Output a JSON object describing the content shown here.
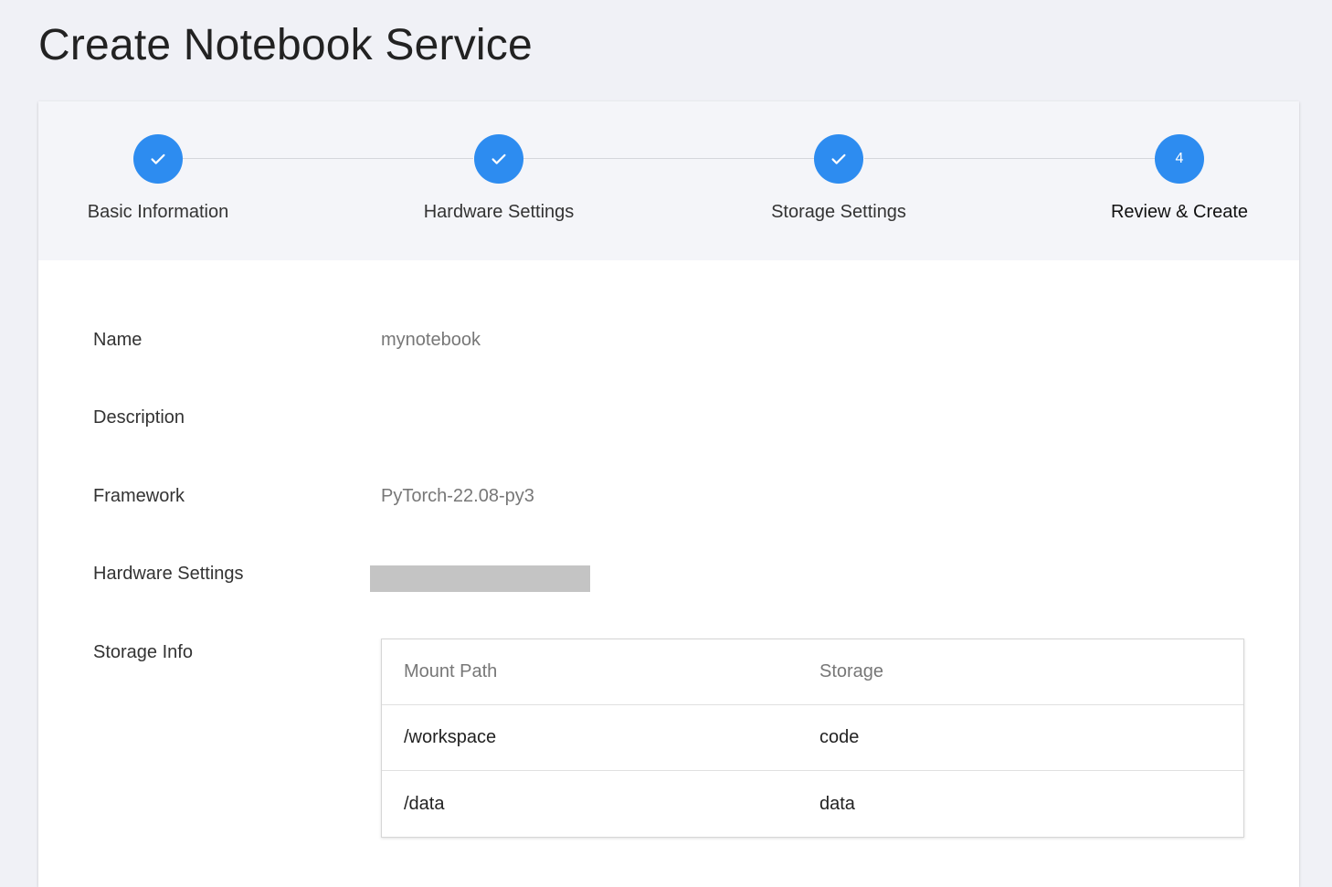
{
  "page": {
    "title": "Create Notebook Service"
  },
  "stepper": {
    "steps": [
      {
        "label": "Basic Information",
        "state": "completed",
        "icon": "check-icon"
      },
      {
        "label": "Hardware Settings",
        "state": "completed",
        "icon": "check-icon"
      },
      {
        "label": "Storage Settings",
        "state": "completed",
        "icon": "check-icon"
      },
      {
        "label": "Review & Create",
        "state": "active",
        "number": "4"
      }
    ],
    "accent_color": "#2d8cf0"
  },
  "review": {
    "name": {
      "label": "Name",
      "value": "mynotebook"
    },
    "description": {
      "label": "Description",
      "value": ""
    },
    "framework": {
      "label": "Framework",
      "value": "PyTorch-22.08-py3"
    },
    "hardware": {
      "label": "Hardware Settings",
      "value_redacted": true
    },
    "storage": {
      "label": "Storage Info",
      "columns": [
        "Mount Path",
        "Storage"
      ],
      "rows": [
        [
          "/workspace",
          "code"
        ],
        [
          "/data",
          "data"
        ]
      ]
    }
  }
}
